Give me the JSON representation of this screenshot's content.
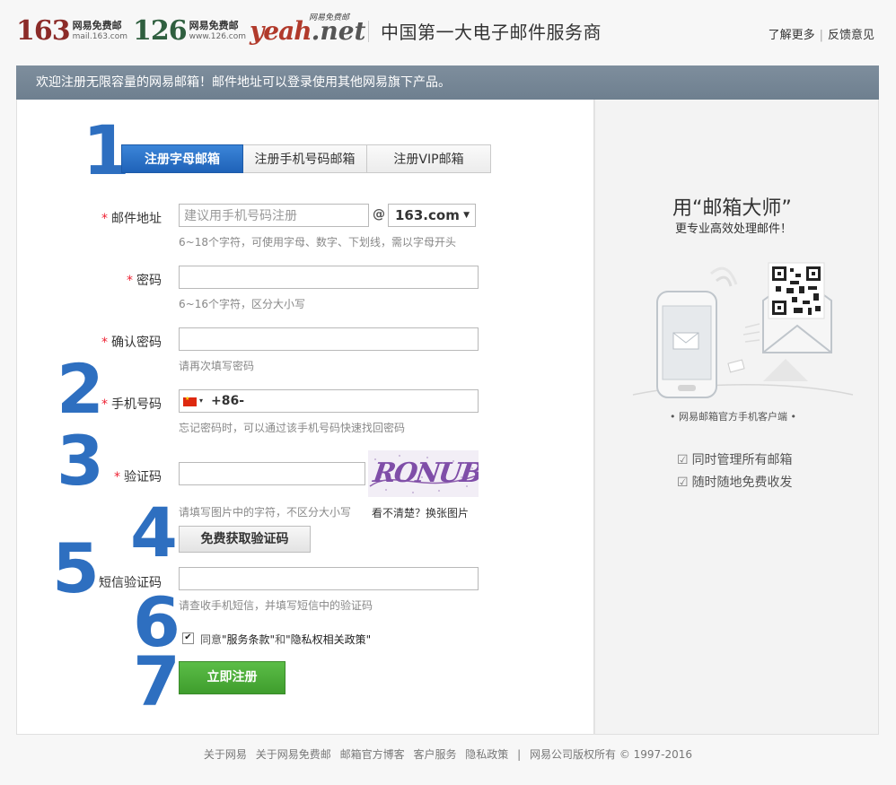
{
  "header": {
    "logo163": {
      "number": "163",
      "line1": "网易免费邮",
      "line2": "mail.163.com"
    },
    "logo126": {
      "number": "126",
      "line1": "网易免费邮",
      "line2": "www.126.com"
    },
    "logoYeah": {
      "yeah": "yeah",
      "net": ".net",
      "tagline": "网易免费邮"
    },
    "slogan": "中国第一大电子邮件服务商",
    "links": [
      "了解更多",
      "反馈意见"
    ]
  },
  "banner": "欢迎注册无限容量的网易邮箱！邮件地址可以登录使用其他网易旗下产品。",
  "steps": [
    "1",
    "2",
    "3",
    "4",
    "5",
    "6",
    "7"
  ],
  "tabs": [
    {
      "label": "注册字母邮箱",
      "active": true
    },
    {
      "label": "注册手机号码邮箱",
      "active": false
    },
    {
      "label": "注册VIP邮箱",
      "active": false
    }
  ],
  "form": {
    "required_mark": "*",
    "email": {
      "label": "邮件地址",
      "placeholder": "建议用手机号码注册",
      "at": "@",
      "domain": "163.com",
      "hint": "6~18个字符，可使用字母、数字、下划线，需以字母开头"
    },
    "password": {
      "label": "密码",
      "hint": "6~16个字符，区分大小写"
    },
    "confirm": {
      "label": "确认密码",
      "hint": "请再次填写密码"
    },
    "phone": {
      "label": "手机号码",
      "prefix": "+86-",
      "hint": "忘记密码时，可以通过该手机号码快速找回密码"
    },
    "captcha": {
      "label": "验证码",
      "hint": "请填写图片中的字符，不区分大小写",
      "image_text": "RONUB",
      "refresh": "看不清楚？换张图片"
    },
    "sms_button": "免费获取验证码",
    "sms": {
      "label": "短信验证码",
      "hint": "请查收手机短信，并填写短信中的验证码"
    },
    "agree": {
      "text_prefix": "同意",
      "terms": "\"服务条款\"",
      "and": "和",
      "privacy": "\"隐私权相关政策\"",
      "checked": true
    },
    "submit": "立即注册"
  },
  "promo": {
    "title": "用“邮箱大师”",
    "subtitle": "更专业高效处理邮件！",
    "caption": "• 网易邮箱官方手机客户端 •",
    "features": [
      "同时管理所有邮箱",
      "随时随地免费收发"
    ]
  },
  "footer": [
    "关于网易",
    "关于网易免费邮",
    "邮箱官方博客",
    "客户服务",
    "隐私政策",
    "|",
    "网易公司版权所有 © 1997-2016"
  ],
  "colors": {
    "accent": "#2e6fc0",
    "submit": "#4aa83a",
    "banner": "#76879a",
    "required": "#e22233"
  }
}
